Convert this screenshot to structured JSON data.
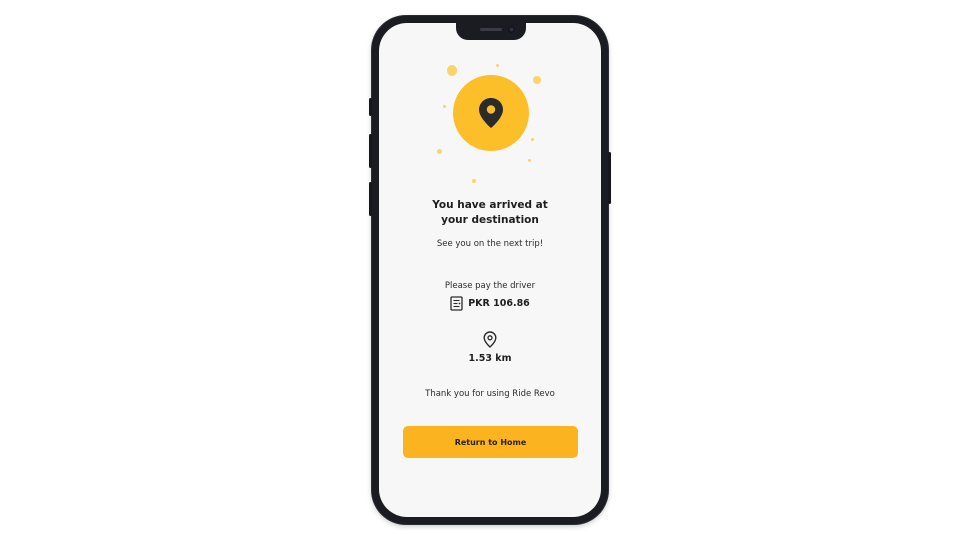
{
  "screen": {
    "title_line1": "You have arrived at",
    "title_line2": "your destination",
    "subtitle": "See you on the next trip!",
    "payment": {
      "label": "Please pay the driver",
      "icon": "receipt-icon",
      "amount": "PKR 106.86"
    },
    "distance": {
      "icon": "location-pin-icon",
      "value": "1.53 km"
    },
    "thanks_text": "Thank you for using Ride Revo",
    "return_button_label": "Return to Home"
  },
  "hero": {
    "icon": "location-pin-icon"
  },
  "colors": {
    "accent": "#fbb41f",
    "hero_circle": "#fcbf2a",
    "hero_dots": "#fcd36b",
    "text": "#1e1e1e",
    "screen_background": "#f7f7f7",
    "phone_frame": "#1a1c22"
  }
}
